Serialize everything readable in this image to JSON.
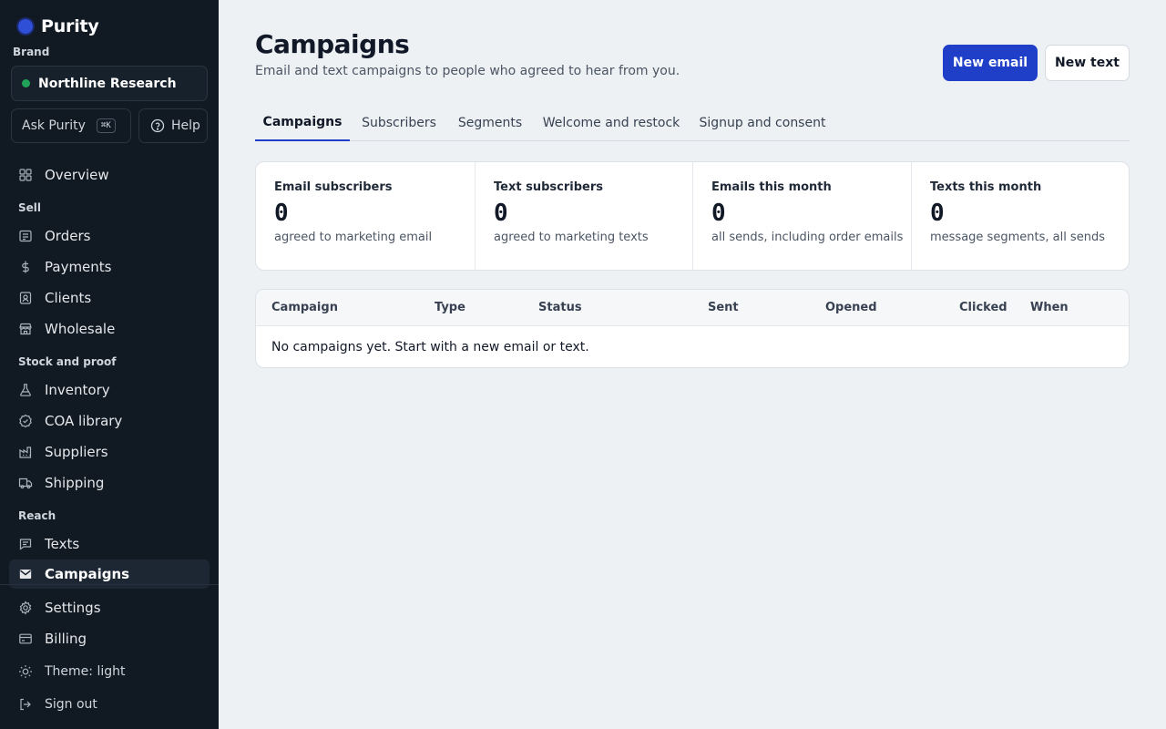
{
  "app": {
    "name": "Purity",
    "brand_color": "#2f4fd6"
  },
  "sidebar": {
    "brand_label": "Brand",
    "brand_name": "Northline Research",
    "ask_label": "Ask Purity",
    "ask_shortcut": "⌘K",
    "help_label": "Help",
    "overview": "Overview",
    "sections": {
      "sell": "Sell",
      "stock": "Stock and proof",
      "reach": "Reach"
    },
    "sell_items": [
      "Orders",
      "Payments",
      "Clients",
      "Wholesale"
    ],
    "stock_items": [
      "Inventory",
      "COA library",
      "Suppliers",
      "Shipping"
    ],
    "reach_items": [
      "Texts",
      "Campaigns"
    ],
    "bottom_items": [
      "Settings",
      "Billing"
    ],
    "theme_label": "Theme: light",
    "signout_label": "Sign out",
    "active_item": "Campaigns"
  },
  "header": {
    "title": "Campaigns",
    "subtitle": "Email and text campaigns to people who agreed to hear from you.",
    "new_email": "New email",
    "new_text": "New text"
  },
  "tabs": [
    "Campaigns",
    "Subscribers",
    "Segments",
    "Welcome and restock",
    "Signup and consent"
  ],
  "stats": [
    {
      "label": "Email subscribers",
      "value": "0",
      "caption": "agreed to marketing email"
    },
    {
      "label": "Text subscribers",
      "value": "0",
      "caption": "agreed to marketing texts"
    },
    {
      "label": "Emails this month",
      "value": "0",
      "caption": "all sends, including order emails"
    },
    {
      "label": "Texts this month",
      "value": "0",
      "caption": "message segments, all sends"
    }
  ],
  "table": {
    "columns": [
      "Campaign",
      "Type",
      "Status",
      "Sent",
      "Opened",
      "Clicked",
      "When"
    ],
    "empty_message": "No campaigns yet. Start with a new email or text."
  }
}
